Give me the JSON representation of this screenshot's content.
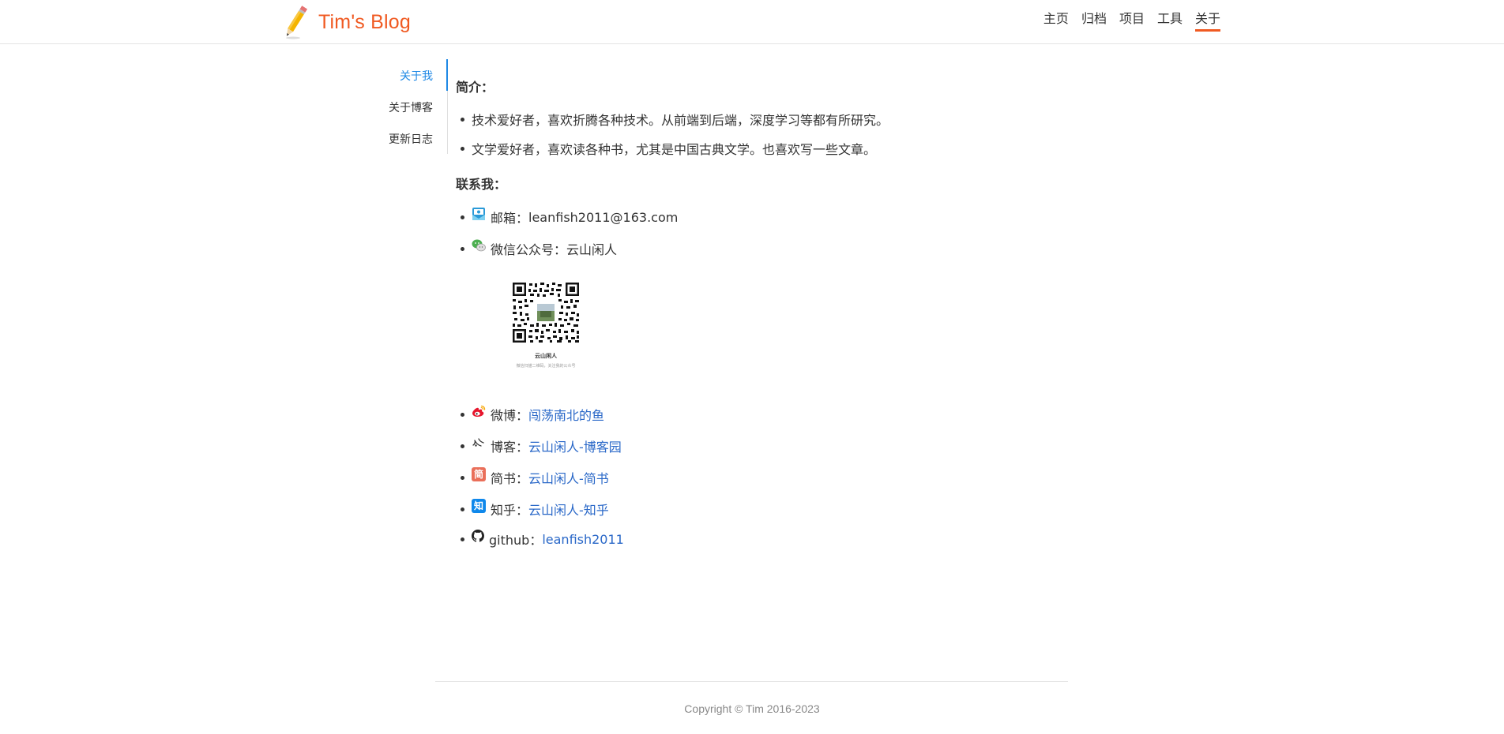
{
  "header": {
    "brand_title": "Tim's Blog",
    "nav": [
      {
        "label": "主页",
        "active": false
      },
      {
        "label": "归档",
        "active": false
      },
      {
        "label": "项目",
        "active": false
      },
      {
        "label": "工具",
        "active": false
      },
      {
        "label": "关于",
        "active": true
      }
    ]
  },
  "toc": {
    "items": [
      {
        "label": "关于我",
        "active": true
      },
      {
        "label": "关于博客",
        "active": false
      },
      {
        "label": "更新日志",
        "active": false
      }
    ]
  },
  "intro": {
    "title": "简介：",
    "items": [
      "技术爱好者，喜欢折腾各种技术。从前端到后端，深度学习等都有所研究。",
      "文学爱好者，喜欢读各种书，尤其是中国古典文学。也喜欢写一些文章。"
    ]
  },
  "contact": {
    "title": "联系我：",
    "email": {
      "label": "邮箱：",
      "value": "leanfish2011@163.com",
      "icon": "mail-icon"
    },
    "wechat": {
      "label": "微信公众号：",
      "value": "云山闲人",
      "icon": "wechat-icon"
    },
    "qr": {
      "name": "云山闲人",
      "caption": "微信扫描二维码，关注我的公众号"
    },
    "links": [
      {
        "label": "微博：",
        "value": "闯荡南北的鱼",
        "icon": "weibo-icon"
      },
      {
        "label": "博客：",
        "value": "云山闲人-博客园",
        "icon": "cnblogs-icon"
      },
      {
        "label": "简书：",
        "value": "云山闲人-简书",
        "icon": "jianshu-icon",
        "glyph": "简"
      },
      {
        "label": "知乎：",
        "value": "云山闲人-知乎",
        "icon": "zhihu-icon",
        "glyph": "知"
      },
      {
        "label": "github：",
        "value": "leanfish2011",
        "icon": "github-icon"
      }
    ]
  },
  "footer": {
    "copyright": "Copyright © Tim 2016-2023"
  },
  "colors": {
    "brand": "#f05a22",
    "link": "#2a68c8",
    "toc_active": "#1e88e5"
  }
}
